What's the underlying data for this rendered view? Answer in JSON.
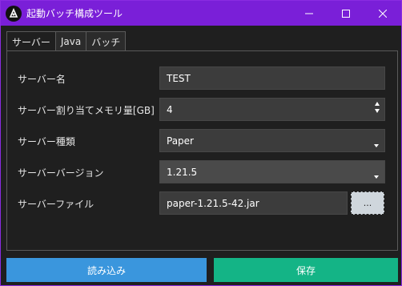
{
  "window": {
    "title": "起動バッチ構成ツール",
    "controls": {
      "minimize": "—",
      "maximize": "☐",
      "close": "✕"
    }
  },
  "tabs": [
    {
      "label": "サーバー",
      "active": true
    },
    {
      "label": "Java",
      "active": false
    },
    {
      "label": "バッチ",
      "active": false
    }
  ],
  "form": {
    "server_name": {
      "label": "サーバー名",
      "value": "TEST"
    },
    "memory": {
      "label": "サーバー割り当てメモリ量[GB]",
      "value": "4"
    },
    "server_type": {
      "label": "サーバー種類",
      "value": "Paper"
    },
    "server_version": {
      "label": "サーバーバージョン",
      "value": "1.21.5"
    },
    "server_file": {
      "label": "サーバーファイル",
      "value": "paper-1.21.5-42.jar",
      "browse_label": "..."
    }
  },
  "buttons": {
    "load": "読み込み",
    "save": "保存"
  },
  "colors": {
    "titlebar": "#7a1fd8",
    "load_button": "#3a96dd",
    "save_button": "#14b486"
  }
}
